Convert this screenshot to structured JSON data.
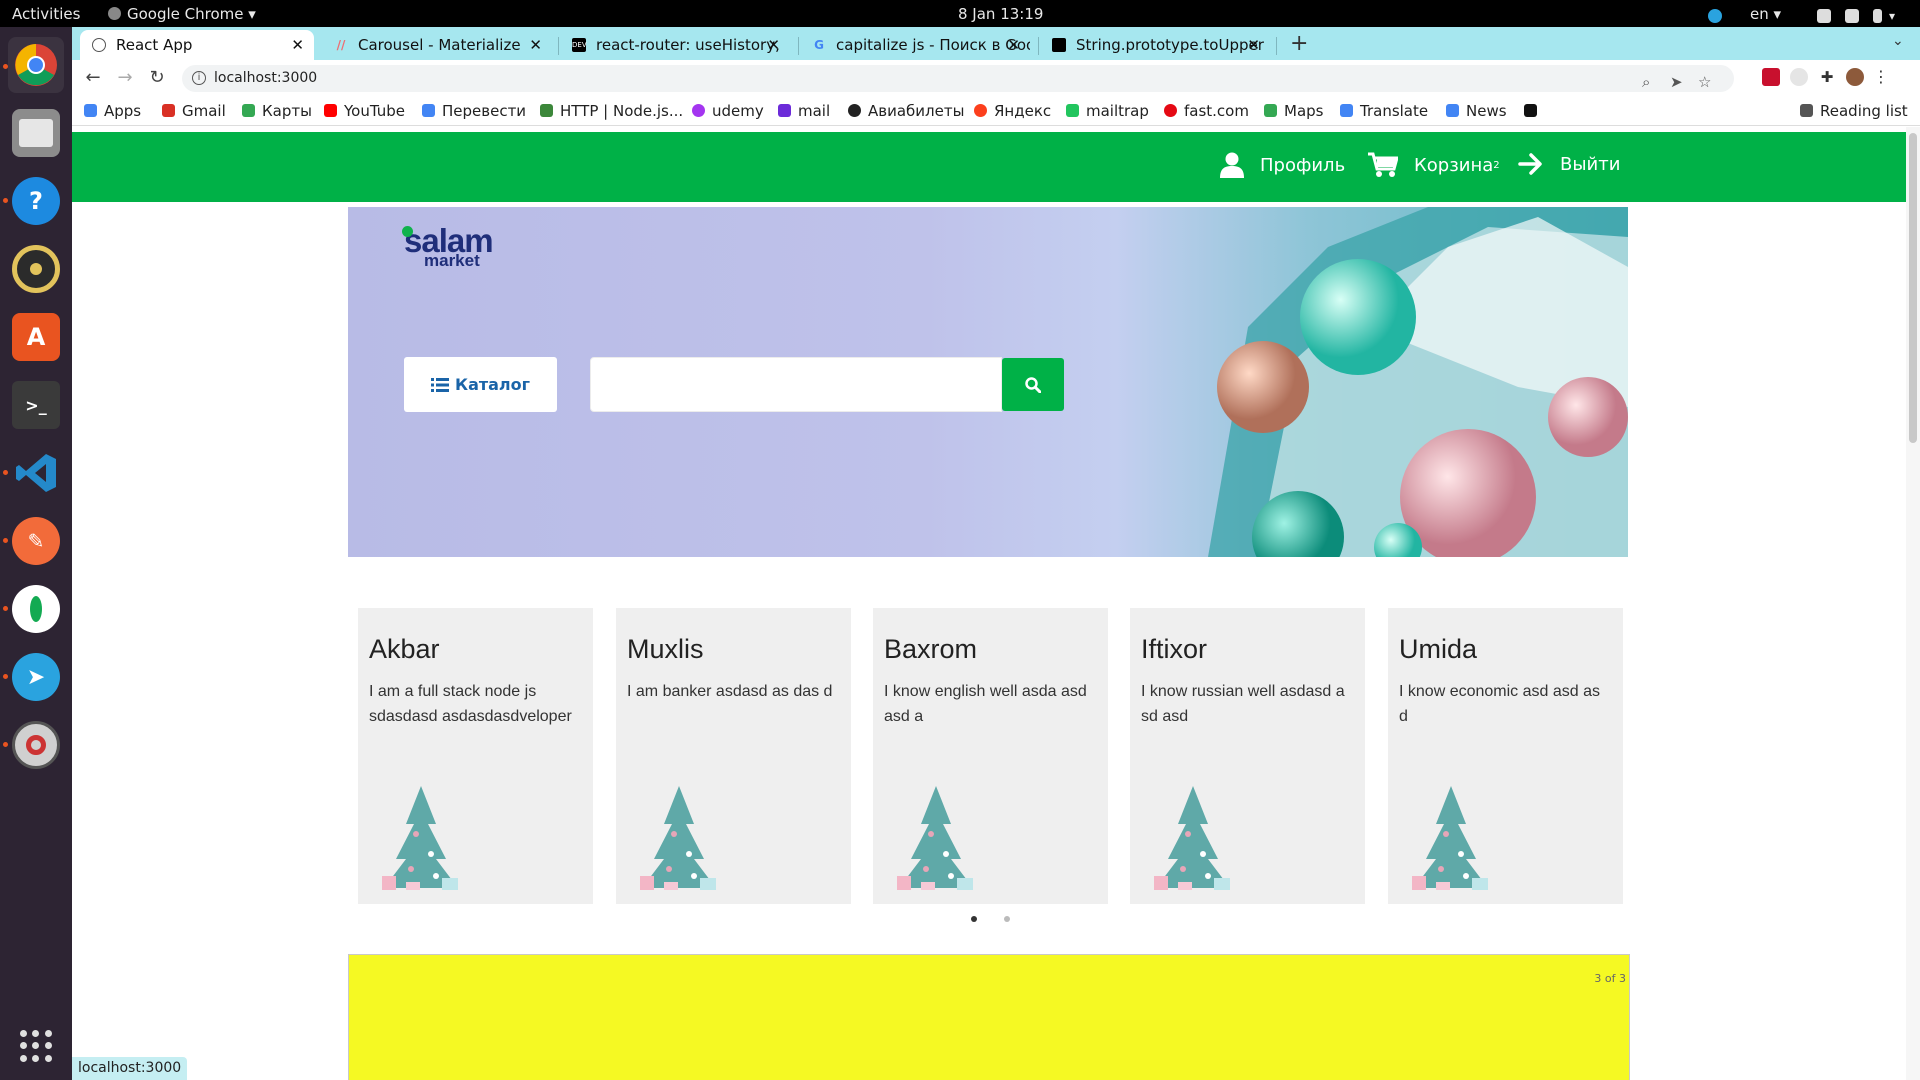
{
  "system": {
    "activities": "Activities",
    "app_menu": "Google Chrome",
    "clock": "8 Jan  13:19",
    "lang": "en"
  },
  "browser": {
    "tabs": [
      {
        "title": "React App",
        "active": true
      },
      {
        "title": "Carousel - Materialize",
        "active": false
      },
      {
        "title": "react-router: useHistory,",
        "active": false
      },
      {
        "title": "capitalize js - Поиск в Goo",
        "active": false
      },
      {
        "title": "String.prototype.toUpper",
        "active": false
      }
    ],
    "url": "localhost:3000",
    "status_url": "localhost:3000",
    "bookmarks": [
      {
        "label": "Apps",
        "color": "#4285f4"
      },
      {
        "label": "Gmail",
        "color": "#d93025"
      },
      {
        "label": "Карты",
        "color": "#34a853"
      },
      {
        "label": "YouTube",
        "color": "#ff0000"
      },
      {
        "label": "Перевести",
        "color": "#4285f4"
      },
      {
        "label": "HTTP | Node.js...",
        "color": "#3c873a"
      },
      {
        "label": "udemy",
        "color": "#a435f0"
      },
      {
        "label": "mail",
        "color": "#6c2bd9"
      },
      {
        "label": "Авиабилеты",
        "color": "#222222"
      },
      {
        "label": "Яндекс",
        "color": "#fc3f1d"
      },
      {
        "label": "mailtrap",
        "color": "#22c55e"
      },
      {
        "label": "fast.com",
        "color": "#e50914"
      },
      {
        "label": "Maps",
        "color": "#34a853"
      },
      {
        "label": "Translate",
        "color": "#4285f4"
      },
      {
        "label": "News",
        "color": "#4285f4"
      }
    ],
    "reading_list": "Reading list"
  },
  "app": {
    "nav": {
      "profile": "Профиль",
      "cart": "Корзина",
      "cart_count": "2",
      "logout": "Выйти"
    },
    "logo": {
      "line1": "salam",
      "line2": "market"
    },
    "catalog_label": "Каталог",
    "search_value": "",
    "cards": [
      {
        "name": "Akbar",
        "text": "I am a full stack node js sdasdasd asdasdasdveloper"
      },
      {
        "name": "Muxlis",
        "text": "I am banker asdasd as das d"
      },
      {
        "name": "Baxrom",
        "text": "I know english well asda asd asd a"
      },
      {
        "name": "Iftixor",
        "text": "I know russian well asdasd a sd asd"
      },
      {
        "name": "Umida",
        "text": "I know economic asd asd as d"
      }
    ],
    "carousel_pages": 2,
    "carousel_active": 1,
    "slide_counter": "3 of 3",
    "colors": {
      "brand_green": "#00b147",
      "slide_yellow": "#f5f923"
    }
  }
}
